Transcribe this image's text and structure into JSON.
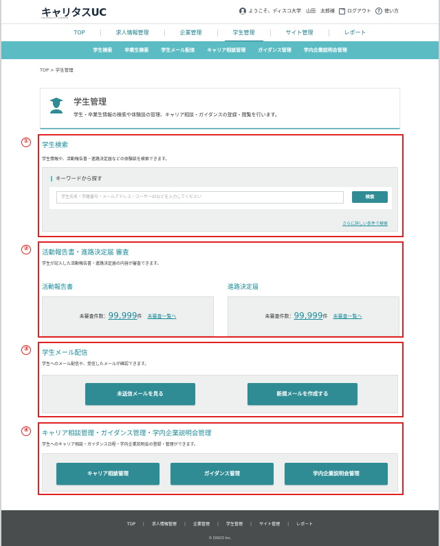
{
  "header": {
    "logo_main": "キャリタスUC",
    "logo_sub": "UNIVERSITY CAREER",
    "welcome": "ようこそ、ディスコ大学　山田　太郎様",
    "logout": "ログアウト",
    "help": "使い方"
  },
  "main_nav": [
    {
      "label": "TOP"
    },
    {
      "label": "求人情報管理"
    },
    {
      "label": "企業管理"
    },
    {
      "label": "学生管理"
    },
    {
      "label": "サイト管理"
    },
    {
      "label": "レポート"
    }
  ],
  "sub_nav": [
    {
      "label": "学生検索"
    },
    {
      "label": "卒業生検索"
    },
    {
      "label": "学生メール配信"
    },
    {
      "label": "キャリア相談管理"
    },
    {
      "label": "ガイダンス管理"
    },
    {
      "label": "学内企業説明会管理"
    }
  ],
  "breadcrumb": "TOP > 学生管理",
  "page": {
    "title": "学生管理",
    "desc": "学生・卒業生情報の検索や体験談の管理、キャリア相談・ガイダンスの登録・閲覧を行います。"
  },
  "markers": [
    "①",
    "②",
    "③",
    "④"
  ],
  "search_section": {
    "title": "学生検索",
    "desc": "学生情報や、活動報告書・進路決定届などの体験談を検索できます。",
    "keyword_label": "キーワードから探す",
    "placeholder": "学生氏名・学籍番号・メールアドレス・ユーザーIDなどを入力してください",
    "search_button": "検索",
    "advanced_link": "さらに詳しい条件で検索"
  },
  "report_section": {
    "title": "活動報告書・進路決定届 審査",
    "desc": "学生が記入した活動報告書・進路決定届の内容が審査できます。",
    "activity": {
      "heading": "活動報告書",
      "label": "未審査件数：",
      "count": "99,999",
      "unit": "件",
      "link": "未審査一覧へ"
    },
    "decision": {
      "heading": "進路決定届",
      "label": "未審査件数：",
      "count": "99,999",
      "unit": "件",
      "link": "未審査一覧へ"
    }
  },
  "mail_section": {
    "title": "学生メール配信",
    "desc": "学生へのメール配信や、受信したメールが確認できます。",
    "unsent_button": "未送信メールを見る",
    "new_button": "新規メールを作成する"
  },
  "career_section": {
    "title": "キャリア相談管理・ガイダンス管理・学内企業説明会管理",
    "desc": "学生へのキャリア相談・ガイダンス日程・学内企業説明会の登録・管理ができます。",
    "career_button": "キャリア相談管理",
    "guidance_button": "ガイダンス管理",
    "briefing_button": "学内企業説明会管理"
  },
  "footer": {
    "links": [
      "TOP",
      "求人情報管理",
      "企業管理",
      "学生管理",
      "サイト管理",
      "レポート"
    ],
    "copyright": "© DISCO Inc."
  },
  "colors": {
    "accent": "#1a8b9a",
    "subnav": "#5bbcc3",
    "button": "#2f8c95",
    "marker": "#e02020",
    "footer": "#4a4d4e"
  }
}
